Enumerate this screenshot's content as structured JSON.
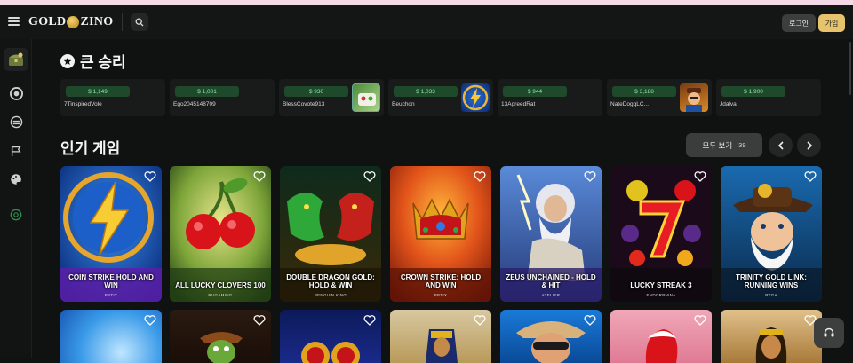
{
  "header": {
    "logo_left": "GOLD",
    "logo_right": "ZINO",
    "login_label": "로그인",
    "join_label": "가입"
  },
  "sidebar": {
    "items": [
      {
        "icon": "treasure-chest-icon"
      },
      {
        "icon": "casino-chip-icon"
      },
      {
        "icon": "live-icon"
      },
      {
        "icon": "flag-icon"
      },
      {
        "icon": "palette-icon"
      },
      {
        "icon": "support-circle-icon"
      }
    ]
  },
  "big_wins": {
    "title": "큰 승리",
    "items": [
      {
        "amount": "$ 1,149",
        "user": "7TinspiredVole",
        "thumb": "none"
      },
      {
        "amount": "$ 1,001",
        "user": "Ego2045148709",
        "thumb": "none"
      },
      {
        "amount": "$ 930",
        "user": "BlessCovote913",
        "thumb": "green-game"
      },
      {
        "amount": "$ 1,033",
        "user": "Beuchon",
        "thumb": "lightning-game"
      },
      {
        "amount": "$ 944",
        "user": "13AgreedRat",
        "thumb": "none"
      },
      {
        "amount": "$ 3,188",
        "user": "NateDoggLC...",
        "thumb": "character-game"
      },
      {
        "amount": "$ 1,900",
        "user": "Jdalval",
        "thumb": "none"
      }
    ]
  },
  "popular": {
    "title": "인기 게임",
    "view_all_label": "모두 보기",
    "view_all_count": "39",
    "games": [
      {
        "title": "COIN STRIKE HOLD AND WIN",
        "provider": "BBTIX"
      },
      {
        "title": "ALL LUCKY CLOVERS 100",
        "provider": "RUGAMING"
      },
      {
        "title": "DOUBLE DRAGON GOLD: HOLD & WIN",
        "provider": "PENGUIN KING"
      },
      {
        "title": "CROWN STRIKE: HOLD AND WIN",
        "provider": "BBTIX"
      },
      {
        "title": "ZEUS UNCHAINED - HOLD & HIT",
        "provider": "ATELIER"
      },
      {
        "title": "LUCKY STREAK 3",
        "provider": "ENDORPHINA"
      },
      {
        "title": "TRINITY GOLD LINK: RUNNING WINS",
        "provider": "RTGA"
      }
    ]
  },
  "colors": {
    "accent_gold": "#e7c46c",
    "win_green": "#8fe3a6",
    "background": "#101211"
  }
}
